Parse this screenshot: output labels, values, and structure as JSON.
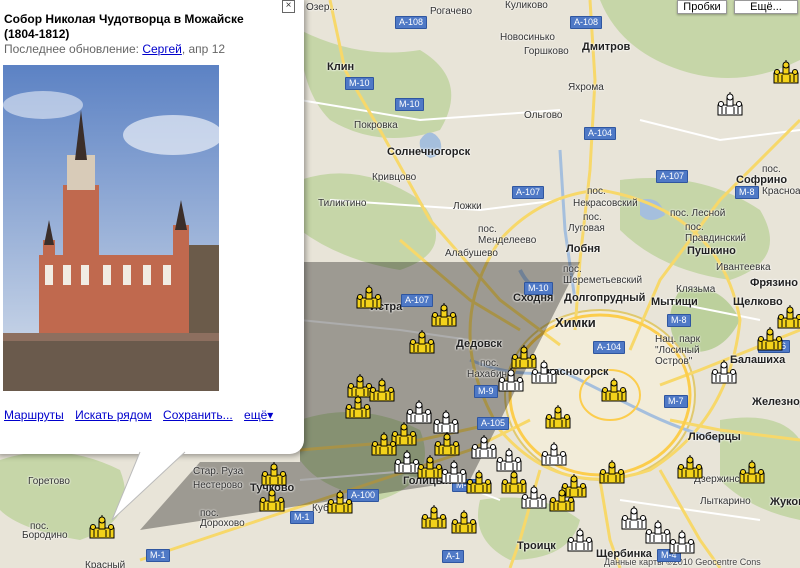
{
  "map_controls": {
    "traffic_label": "Пробки",
    "more_label": "Ещё..."
  },
  "popup": {
    "title": "Собор Николая Чудотворца в Можайске (1804-1812)",
    "updated_prefix": "Последнее обновление:",
    "updated_user": "Сергей",
    "updated_date": ", апр 12",
    "links": {
      "routes": "Маршруты",
      "search_nearby": "Искать рядом",
      "save": "Сохранить...",
      "more": "ещё▾"
    }
  },
  "places": {
    "ozer": "Озер...",
    "rogachevo": "Рогачево",
    "kulikovo": "Куликово",
    "dmitrov": "Дмитров",
    "novosinkovo": "Новосинько",
    "gorshkovo": "Горшково",
    "klin": "Клин",
    "yakhroma": "Яхрома",
    "olgovo": "Ольгово",
    "pokrovka": "Покровка",
    "solnechnogorsk": "Солнечногорск",
    "krivtsovo": "Кривцово",
    "pos": "пос.",
    "sofrino": "Софрино",
    "krasnoar": "Красноар",
    "tiliktino": "Тиликтино",
    "lozhki": "Ложки",
    "nekrasovsky": "Некрасовский",
    "lugovaya": "Луговая",
    "lesnoy": "пос. Лесной",
    "pravdinsky": "Правдинский",
    "mendeleevo": "Менделеево",
    "lobnya": "Лобня",
    "pushkino": "Пушкино",
    "alabushevo": "Алабушево",
    "ivanteevka": "Ивантеевка",
    "sheremetyevsky": "Шереметьевский",
    "klyazma": "Клязьма",
    "fryazino": "Фрязино",
    "istra": "Истра",
    "skhodnya": "Сходня",
    "dolgoprudny": "Долгопрудный",
    "mytishchi": "Мытищи",
    "shchelkovo": "Щелково",
    "dedovsk": "Дедовск",
    "khimki": "Химки",
    "nakhabino": "Нахабино",
    "krasnogorsk": "Красногорск",
    "nats_park": "Нац. парк \"Лосиный Остров\"",
    "balashikha": "Балашиха",
    "zheleznodor": "Железнодор",
    "lyubertsy": "Люберцы",
    "goretovo": "Горетово",
    "star_ruza": "Стар. Руза",
    "tuchkovo": "Тучково",
    "golitsyno": "Голицыно",
    "nesterovo": "Нестерово",
    "dzerzhinsky": "Дзержинский",
    "kubinka": "Кубинка",
    "lytkarino": "Лыткарино",
    "zhukovsky": "Жуковск",
    "borodino": "Бородино",
    "dorokhovo": "Дорохово",
    "troitsk": "Троицк",
    "shcherbinka": "Щербинка",
    "krasny": "Красный",
    "copyright": "Данные карты ©2010 Geocentre Cons"
  },
  "roads": {
    "a108a": "A-108",
    "a108b": "A-108",
    "m10a": "M-10",
    "m10b": "M-10",
    "m10c": "M-10",
    "a104a": "A-104",
    "a104b": "A-104",
    "a107a": "A-107",
    "a107b": "A-107",
    "a107c": "A-107",
    "m8a": "M-8",
    "m8b": "M-8",
    "m9": "M-9",
    "m7": "M-7",
    "a105": "A-105",
    "a106": "A-106",
    "a100": "A-100",
    "m1a": "M-1",
    "m1b": "M-1",
    "m4": "M-4",
    "m3": "M-3",
    "a1": "A-1"
  },
  "colors": {
    "water": "#a5bfdd",
    "forest": "#c2d3a5",
    "city": "#f2ecd9",
    "motorway": "#fccd4d",
    "major": "#f9e79a",
    "shadow": "#000000"
  }
}
